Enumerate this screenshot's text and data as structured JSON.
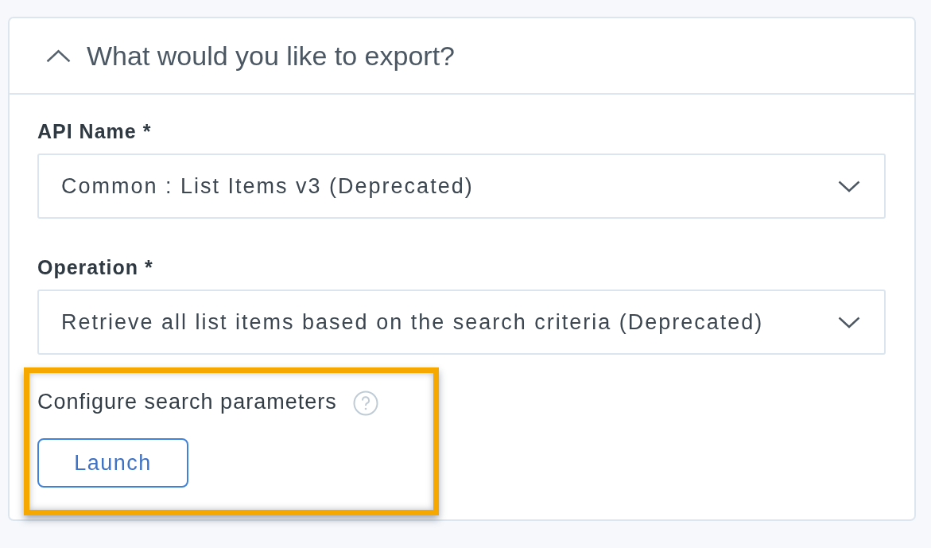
{
  "panel": {
    "title": "What would you like to export?",
    "expanded": true
  },
  "fields": [
    {
      "label": "API Name *",
      "value": "Common : List Items v3 (Deprecated)"
    },
    {
      "label": "Operation *",
      "value": "Retrieve all list items based on the search criteria (Deprecated)"
    }
  ],
  "parameters": {
    "label": "Configure search parameters",
    "highlighted": true,
    "button": "Launch"
  }
}
